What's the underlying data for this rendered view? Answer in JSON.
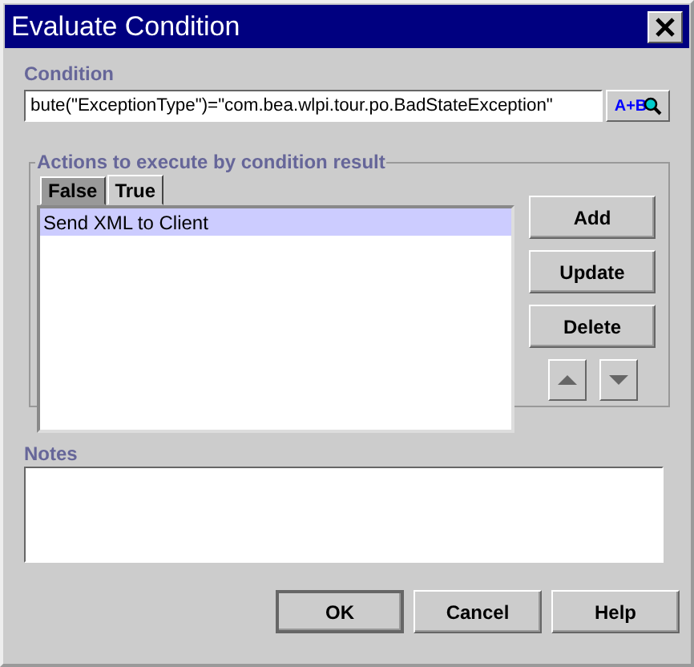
{
  "window": {
    "title": "Evaluate Condition"
  },
  "condition": {
    "label": "Condition",
    "value": "bute(\"ExceptionType\")=\"com.bea.wlpi.tour.po.BadStateException\"",
    "expression_button": "A+B"
  },
  "actions": {
    "title": "Actions to execute by condition result",
    "tabs": [
      {
        "label": "False",
        "selected": false
      },
      {
        "label": "True",
        "selected": true
      }
    ],
    "items": [
      {
        "label": "Send XML to Client",
        "selected": true
      }
    ],
    "buttons": [
      "Add",
      "Update",
      "Delete"
    ]
  },
  "notes": {
    "label": "Notes"
  },
  "buttons": [
    {
      "label": "OK",
      "default": true
    },
    {
      "label": "Cancel",
      "default": false
    },
    {
      "label": "Help",
      "default": false
    }
  ]
}
